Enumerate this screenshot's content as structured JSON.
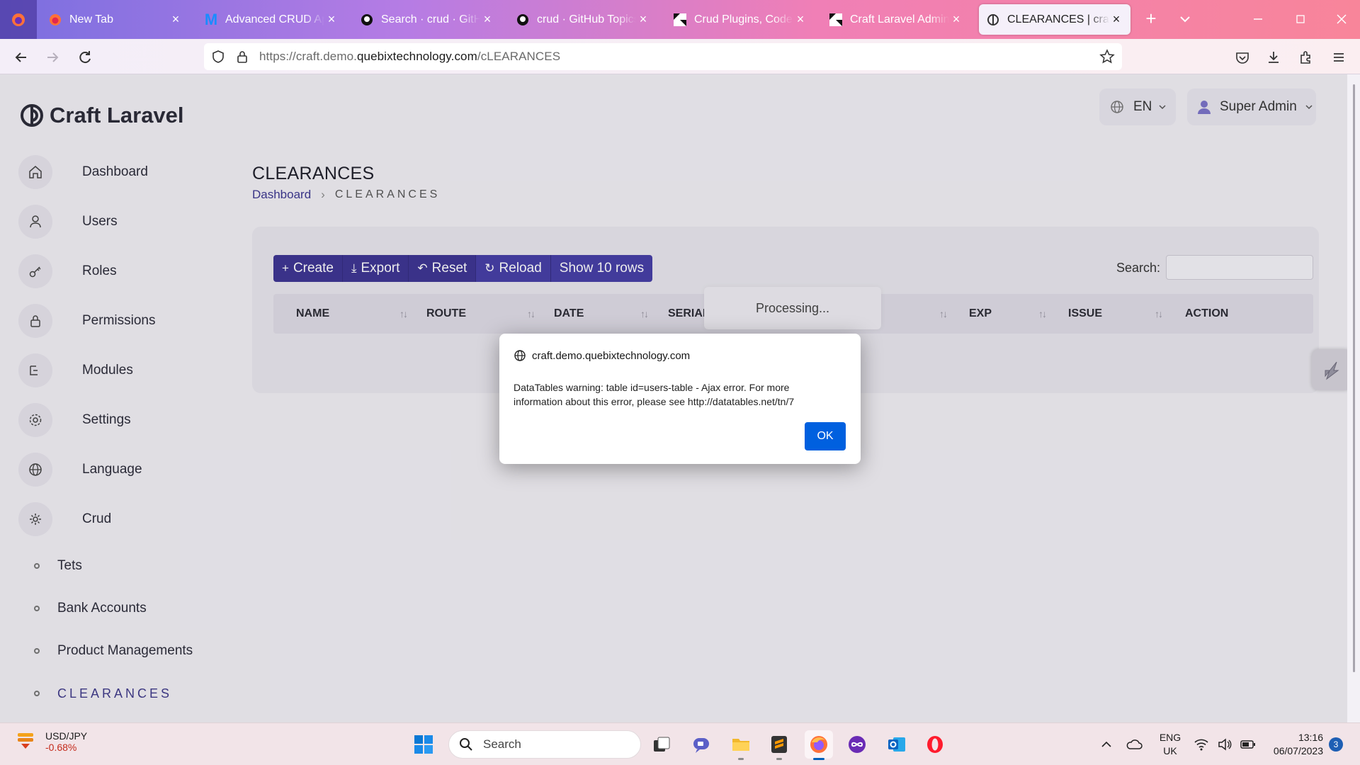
{
  "browser": {
    "tabs": [
      {
        "label": "New Tab",
        "icon": "firefox-icon"
      },
      {
        "label": "Advanced CRUD Application",
        "icon": "medium-m-icon"
      },
      {
        "label": "Search · crud · GitHub",
        "icon": "github-icon"
      },
      {
        "label": "crud · GitHub Topics · GitHub",
        "icon": "github-icon"
      },
      {
        "label": "Crud Plugins, Code & Scripts",
        "icon": "codecanyon-icon"
      },
      {
        "label": "Craft Laravel Admin Panel",
        "icon": "codecanyon-icon"
      },
      {
        "label": "CLEARANCES | craftlaravel",
        "icon": "craft-logo-icon"
      }
    ],
    "url_prefix": "https://craft.demo.",
    "url_host": "quebixtechnology.com",
    "url_path": "/cLEARANCES"
  },
  "app": {
    "logo_text": "Craft Laravel",
    "language": "EN",
    "user": "Super Admin",
    "menu": [
      {
        "label": "Dashboard",
        "icon": "home-icon"
      },
      {
        "label": "Users",
        "icon": "user-icon"
      },
      {
        "label": "Roles",
        "icon": "key-icon"
      },
      {
        "label": "Permissions",
        "icon": "lock-icon"
      },
      {
        "label": "Modules",
        "icon": "modules-icon"
      },
      {
        "label": "Settings",
        "icon": "gear-icon"
      },
      {
        "label": "Language",
        "icon": "globe-icon"
      },
      {
        "label": "Crud",
        "icon": "crud-icon"
      }
    ],
    "submenu": [
      {
        "label": "Tets"
      },
      {
        "label": "Bank Accounts"
      },
      {
        "label": "Product Managements"
      },
      {
        "label": "CLEARANCES"
      }
    ]
  },
  "page": {
    "title": "CLEARANCES",
    "breadcrumb": [
      "Dashboard",
      "CLEARANCES"
    ],
    "toolbar": {
      "create": "Create",
      "export": "Export",
      "reset": "Reset",
      "reload": "Reload",
      "show_rows": "Show 10 rows"
    },
    "search_label": "Search:",
    "columns": [
      "NAME",
      "ROUTE",
      "DATE",
      "SERIAL",
      "EXP",
      "ISSUE",
      "ACTION"
    ],
    "processing": "Processing..."
  },
  "dialog": {
    "host": "craft.demo.quebixtechnology.com",
    "message": "DataTables warning: table id=users-table - Ajax error. For more information about this error, please see http://datatables.net/tn/7",
    "ok": "OK"
  },
  "taskbar": {
    "widget_title": "USD/JPY",
    "widget_value": "-0.68%",
    "search": "Search",
    "lang_top": "ENG",
    "lang_bottom": "UK",
    "time": "13:16",
    "date": "06/07/2023",
    "notifications": "3"
  }
}
